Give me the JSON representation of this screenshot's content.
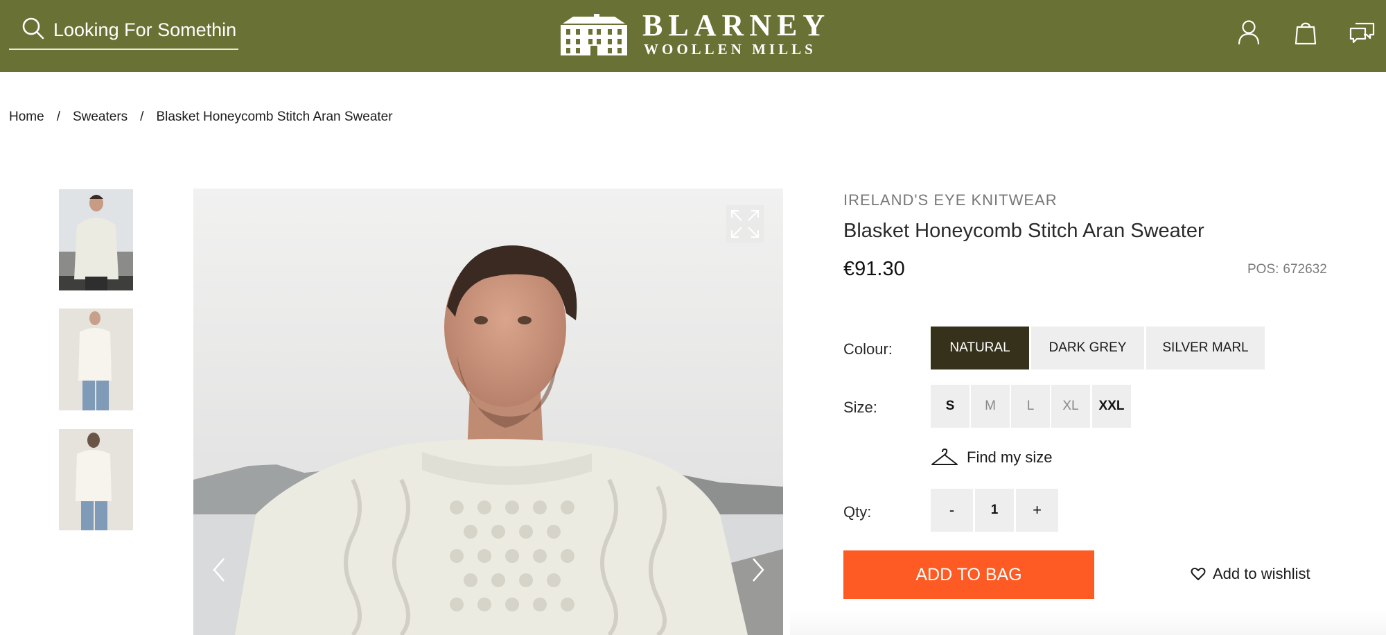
{
  "header": {
    "search_placeholder": "Looking For Something?",
    "logo_title": "BLARNEY",
    "logo_subtitle": "WOOLLEN MILLS",
    "brand_color": "#6a7135"
  },
  "breadcrumb": {
    "items": [
      "Home",
      "Sweaters",
      "Blasket Honeycomb Stitch Aran Sweater"
    ],
    "separator": "/"
  },
  "product": {
    "brand": "IRELAND'S EYE KNITWEAR",
    "title": "Blasket Honeycomb Stitch Aran Sweater",
    "price": "€91.30",
    "pos_label": "POS:",
    "pos_value": "672632",
    "colour_label": "Colour:",
    "colours": [
      "NATURAL",
      "DARK GREY",
      "SILVER MARL"
    ],
    "selected_colour": "NATURAL",
    "size_label": "Size:",
    "sizes": [
      "S",
      "M",
      "L",
      "XL",
      "XXL"
    ],
    "available_sizes": [
      "S",
      "XXL"
    ],
    "find_size_label": "Find my size",
    "qty_label": "Qty:",
    "qty_minus": "-",
    "qty_value": "1",
    "qty_plus": "+",
    "add_to_bag_label": "ADD TO BAG",
    "wishlist_label": "Add to wishlist",
    "accent_color": "#fe5b24",
    "selected_swatch_color": "#35311b"
  },
  "gallery": {
    "thumbnail_count": 3,
    "main_image_subject": "man wearing cream aran sweater by the sea"
  },
  "icons": {
    "search": "search-icon",
    "account": "user-icon",
    "bag": "bag-icon",
    "chat": "chat-icon",
    "hanger": "hanger-icon",
    "heart": "heart-icon",
    "expand": "expand-icon"
  }
}
